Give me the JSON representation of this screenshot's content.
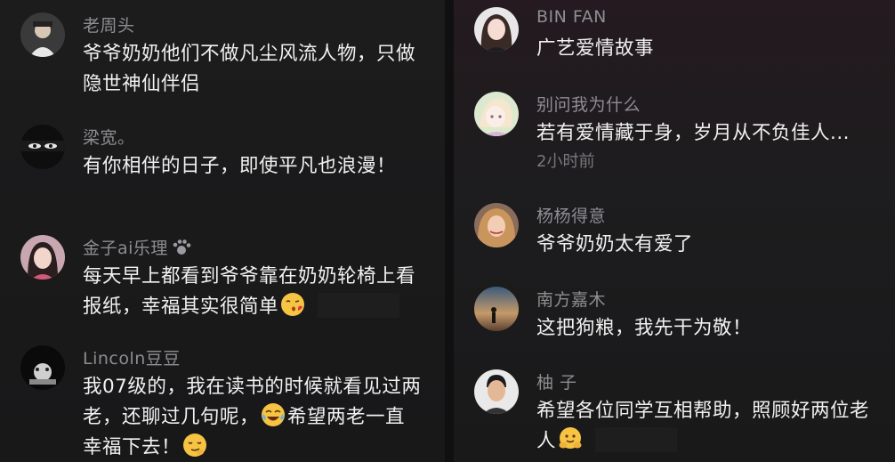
{
  "left_comments": [
    {
      "name": "老周头",
      "lines": [
        "爷爷奶奶他们不做凡尘风流人物，只做",
        "隐世神仙伴侣"
      ]
    },
    {
      "name": "梁宽。",
      "lines": [
        "有你相伴的日子，即使平凡也浪漫！"
      ]
    },
    {
      "name": "金子ai乐理",
      "name_icon": "paw-icon",
      "lines": [
        "每天早上都看到爷爷靠在奶奶轮椅上看",
        "报纸，幸福其实很简单"
      ],
      "emoji": "kiss-face-emoji"
    },
    {
      "name": "Lincoln豆豆",
      "lines": [
        "我07级的，我在读书的时候就看见过两",
        "老，还聊过几句呢，",
        "希望两老一直",
        "幸福下去！"
      ],
      "emojis": [
        "tears-of-joy-emoji",
        "smirk-face-emoji"
      ]
    }
  ],
  "right_comments": [
    {
      "name": "BIN FAN",
      "lines": [
        "广艺爱情故事"
      ]
    },
    {
      "name": "别问我为什么",
      "lines": [
        "若有爱情藏于身，岁月从不负佳人..."
      ],
      "time": "2小时前"
    },
    {
      "name": "杨杨得意",
      "lines": [
        "爷爷奶奶太有爱了"
      ]
    },
    {
      "name": "南方嘉木",
      "lines": [
        "这把狗粮，我先干为敬！"
      ]
    },
    {
      "name": "柚 子",
      "lines": [
        "希望各位同学互相帮助，照顾好两位老",
        "人"
      ],
      "emoji": "hugging-face-emoji"
    }
  ],
  "colors": {
    "background": "#151516",
    "name_text": "#8d8d92",
    "comment_text": "#f1f1f1",
    "time_text": "#77777c"
  }
}
